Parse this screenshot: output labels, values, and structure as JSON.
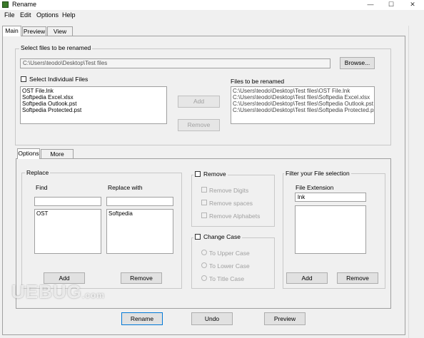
{
  "window": {
    "title": "Rename",
    "minimize": "—",
    "maximize": "☐",
    "close": "✕",
    "accent_color": "#3b7a2a"
  },
  "menu": {
    "items": [
      "File",
      "Edit",
      "Options",
      "Help"
    ]
  },
  "main_tabs": {
    "items": [
      "Main",
      "Preview",
      "View Log"
    ],
    "active": "Main"
  },
  "select_files": {
    "legend": "Select files to be renamed",
    "path_value": "C:\\Users\\teodo\\Desktop\\Test files",
    "browse_label": "Browse...",
    "select_individual_label": "Select Individual Files",
    "source_files": [
      "OST File.lnk",
      "Softpedia Excel.xlsx",
      "Softpedia Outlook.pst",
      "Softpedia Protected.pst"
    ],
    "add_label": "Add",
    "remove_label": "Remove",
    "to_rename_label": "Files to be renamed",
    "files_to_rename": [
      "C:\\Users\\teodo\\Desktop\\Test files\\OST File.lnk",
      "C:\\Users\\teodo\\Desktop\\Test files\\Softpedia Excel.xlsx",
      "C:\\Users\\teodo\\Desktop\\Test files\\Softpedia Outlook.pst",
      "C:\\Users\\teodo\\Desktop\\Test files\\Softpedia Protected.pst"
    ]
  },
  "option_tabs": {
    "items": [
      "Options",
      "More Options"
    ],
    "active": "Options"
  },
  "replace": {
    "legend": "Replace",
    "find_label": "Find",
    "replace_with_label": "Replace with",
    "find_input": "",
    "replace_input": "",
    "find_items": [
      "OST"
    ],
    "replace_items": [
      "Softpedia"
    ],
    "add_label": "Add",
    "remove_label": "Remove"
  },
  "remove": {
    "legend": "Remove",
    "options": [
      "Remove Digits",
      "Remove spaces",
      "Remove Alphabets"
    ]
  },
  "change_case": {
    "legend": "Change Case",
    "options": [
      "To Upper Case",
      "To Lower Case",
      "To Title Case"
    ]
  },
  "filter": {
    "legend": "Filter your File selection",
    "extension_label": "File Extension",
    "extension_input": "lnk",
    "extension_items": [],
    "add_label": "Add",
    "remove_label": "Remove"
  },
  "actions": {
    "rename_label": "Rename",
    "undo_label": "Undo",
    "preview_label": "Preview"
  },
  "watermark": {
    "text": "UEBUG",
    "suffix": ".com"
  }
}
